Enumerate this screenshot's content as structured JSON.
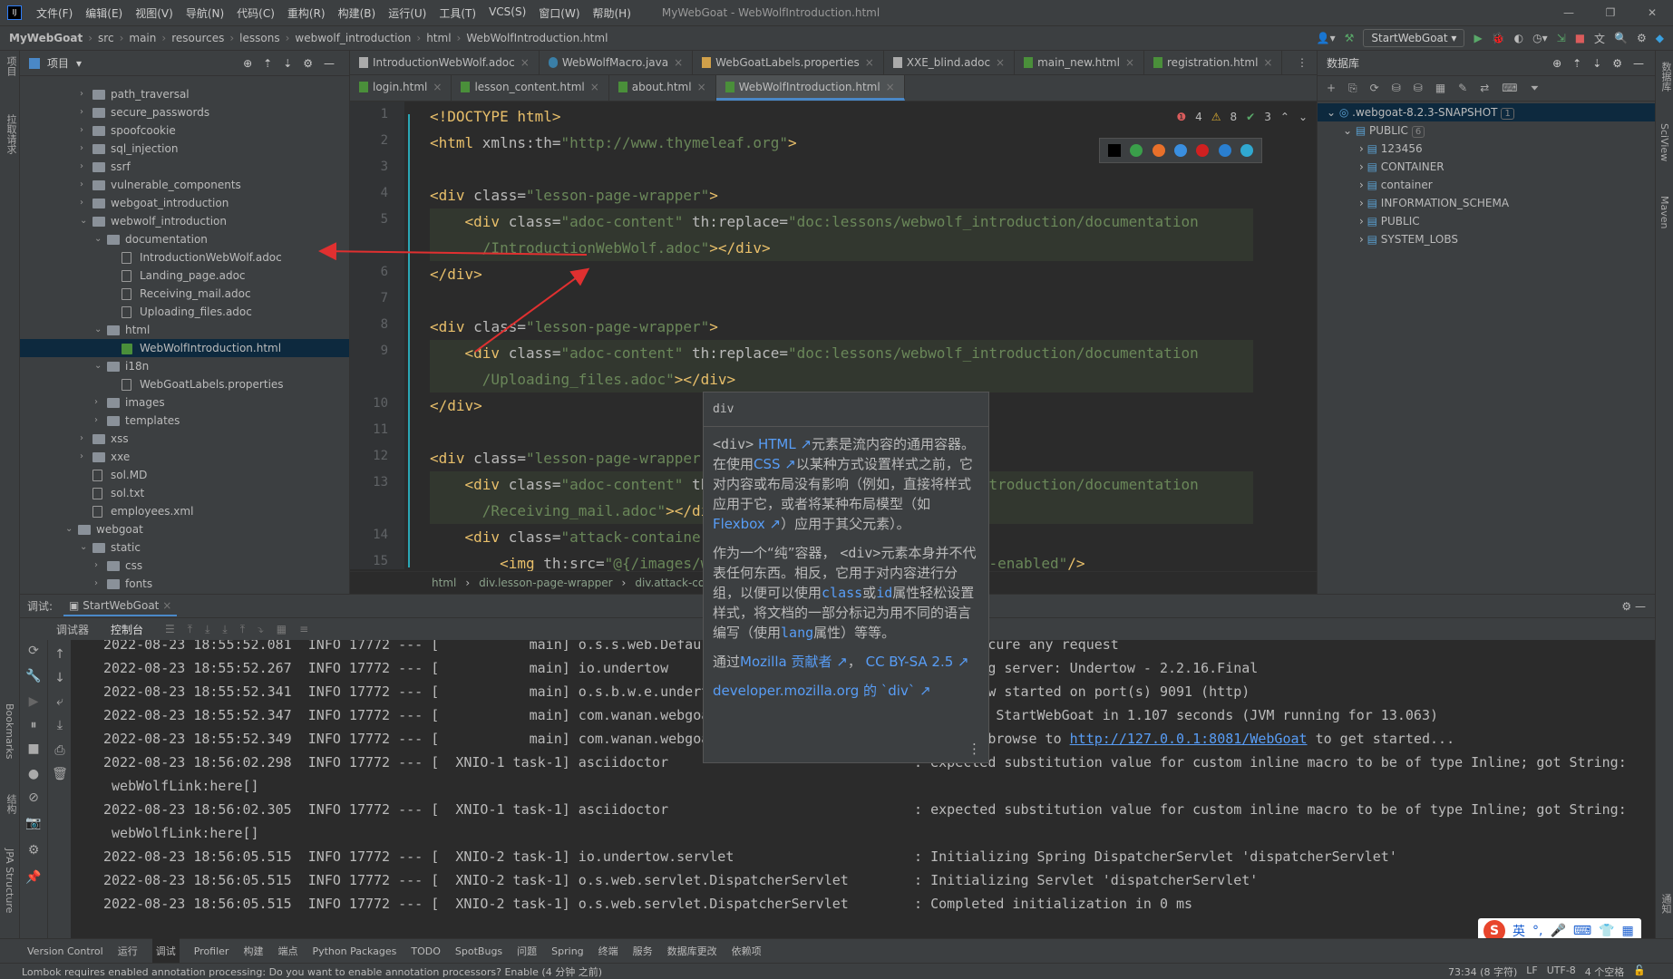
{
  "window": {
    "title": "MyWebGoat - WebWolfIntroduction.html",
    "controls": [
      "—",
      "❐",
      "✕"
    ]
  },
  "menu": [
    "文件(F)",
    "编辑(E)",
    "视图(V)",
    "导航(N)",
    "代码(C)",
    "重构(R)",
    "构建(B)",
    "运行(U)",
    "工具(T)",
    "VCS(S)",
    "窗口(W)",
    "帮助(H)"
  ],
  "breadcrumb": [
    "MyWebGoat",
    "src",
    "main",
    "resources",
    "lessons",
    "webwolf_introduction",
    "html",
    "WebWolfIntroduction.html"
  ],
  "run_config": "StartWebGoat",
  "left_strip": [
    "项目",
    "拉取请求",
    "Bookmarks",
    "结构",
    "JPA Structure"
  ],
  "right_strip": [
    "数据库",
    "SciView",
    "Maven",
    "通知"
  ],
  "project": {
    "title": "项目",
    "items": [
      {
        "label": "path_traversal",
        "level": 0,
        "type": "folder",
        "arrow": "›"
      },
      {
        "label": "secure_passwords",
        "level": 0,
        "type": "folder",
        "arrow": "›"
      },
      {
        "label": "spoofcookie",
        "level": 0,
        "type": "folder",
        "arrow": "›"
      },
      {
        "label": "sql_injection",
        "level": 0,
        "type": "folder",
        "arrow": "›"
      },
      {
        "label": "ssrf",
        "level": 0,
        "type": "folder",
        "arrow": "›"
      },
      {
        "label": "vulnerable_components",
        "level": 0,
        "type": "folder",
        "arrow": "›"
      },
      {
        "label": "webgoat_introduction",
        "level": 0,
        "type": "folder",
        "arrow": "›"
      },
      {
        "label": "webwolf_introduction",
        "level": 0,
        "type": "folder",
        "arrow": "⌄"
      },
      {
        "label": "documentation",
        "level": 1,
        "type": "folder",
        "arrow": "⌄"
      },
      {
        "label": "IntroductionWebWolf.adoc",
        "level": 2,
        "type": "file"
      },
      {
        "label": "Landing_page.adoc",
        "level": 2,
        "type": "file"
      },
      {
        "label": "Receiving_mail.adoc",
        "level": 2,
        "type": "file"
      },
      {
        "label": "Uploading_files.adoc",
        "level": 2,
        "type": "file"
      },
      {
        "label": "html",
        "level": 1,
        "type": "folder",
        "arrow": "⌄"
      },
      {
        "label": "WebWolfIntroduction.html",
        "level": 2,
        "type": "html",
        "selected": true
      },
      {
        "label": "i18n",
        "level": 1,
        "type": "folder",
        "arrow": "⌄"
      },
      {
        "label": "WebGoatLabels.properties",
        "level": 2,
        "type": "file"
      },
      {
        "label": "images",
        "level": 1,
        "type": "folder",
        "arrow": "›"
      },
      {
        "label": "templates",
        "level": 1,
        "type": "folder",
        "arrow": "›"
      },
      {
        "label": "xss",
        "level": 0,
        "type": "folder",
        "arrow": "›"
      },
      {
        "label": "xxe",
        "level": 0,
        "type": "folder",
        "arrow": "›"
      },
      {
        "label": "sol.MD",
        "level": 0,
        "type": "file"
      },
      {
        "label": "sol.txt",
        "level": 0,
        "type": "file"
      },
      {
        "label": "employees.xml",
        "level": 0,
        "type": "file"
      },
      {
        "label": "webgoat",
        "level": -1,
        "type": "folder",
        "arrow": "⌄"
      },
      {
        "label": "static",
        "level": 0,
        "type": "folder",
        "arrow": "⌄"
      },
      {
        "label": "css",
        "level": 1,
        "type": "folder",
        "arrow": "›"
      },
      {
        "label": "fonts",
        "level": 1,
        "type": "folder",
        "arrow": "›"
      },
      {
        "label": "js",
        "level": 1,
        "type": "folder",
        "arrow": "›"
      }
    ]
  },
  "editor": {
    "tabs_row1": [
      {
        "label": "IntroductionWebWolf.adoc",
        "icon": "ad"
      },
      {
        "label": "WebWolfMacro.java",
        "icon": "j"
      },
      {
        "label": "WebGoatLabels.properties",
        "icon": "p"
      },
      {
        "label": "XXE_blind.adoc",
        "icon": "ad"
      },
      {
        "label": "main_new.html",
        "icon": "h"
      },
      {
        "label": "registration.html",
        "icon": "h"
      }
    ],
    "tabs_row2": [
      {
        "label": "login.html"
      },
      {
        "label": "lesson_content.html"
      },
      {
        "label": "about.html"
      },
      {
        "label": "WebWolfIntroduction.html",
        "active": true
      }
    ],
    "inspections": {
      "errors": "4",
      "warnings": "8",
      "weak": "3"
    },
    "lines": [
      {
        "n": "1",
        "seg": [
          [
            "t",
            "<!DOCTYPE html>"
          ]
        ]
      },
      {
        "n": "2",
        "seg": [
          [
            "t",
            "<html "
          ],
          [
            "a",
            "xmlns:th="
          ],
          [
            "s",
            "\"http://www.thymeleaf.org\""
          ],
          [
            "t",
            ">"
          ]
        ]
      },
      {
        "n": "3",
        "seg": []
      },
      {
        "n": "4",
        "seg": [
          [
            "t",
            "<div "
          ],
          [
            "a",
            "class="
          ],
          [
            "s",
            "\"lesson-page-wrapper\""
          ],
          [
            "t",
            ">"
          ]
        ]
      },
      {
        "n": "5",
        "hl": true,
        "seg": [
          [
            "p",
            "    "
          ],
          [
            "t",
            "<div "
          ],
          [
            "a",
            "class="
          ],
          [
            "s",
            "\"adoc-content\" "
          ],
          [
            "a",
            "th:replace="
          ],
          [
            "s",
            "\"doc:lessons/webwolf_introduction/documentation"
          ]
        ]
      },
      {
        "n": "",
        "hl": true,
        "seg": [
          [
            "s",
            "      /IntroductionWebWolf.adoc\""
          ],
          [
            "t",
            "></div>"
          ]
        ]
      },
      {
        "n": "6",
        "seg": [
          [
            "t",
            "</div>"
          ]
        ]
      },
      {
        "n": "7",
        "seg": []
      },
      {
        "n": "8",
        "seg": [
          [
            "t",
            "<div "
          ],
          [
            "a",
            "class="
          ],
          [
            "s",
            "\"lesson-page-wrapper\""
          ],
          [
            "t",
            ">"
          ]
        ]
      },
      {
        "n": "9",
        "hl": true,
        "seg": [
          [
            "p",
            "    "
          ],
          [
            "t",
            "<div "
          ],
          [
            "a",
            "class="
          ],
          [
            "s",
            "\"adoc-content\" "
          ],
          [
            "a",
            "th:replace="
          ],
          [
            "s",
            "\"doc:lessons/webwolf_introduction/documentation"
          ]
        ]
      },
      {
        "n": "",
        "hl": true,
        "seg": [
          [
            "s",
            "      /Uploading_files.adoc\""
          ],
          [
            "t",
            "></div>"
          ]
        ]
      },
      {
        "n": "10",
        "seg": [
          [
            "t",
            "</div>"
          ]
        ]
      },
      {
        "n": "11",
        "seg": []
      },
      {
        "n": "12",
        "seg": [
          [
            "t",
            "<div "
          ],
          [
            "a",
            "class="
          ],
          [
            "s",
            "\"lesson-page-wrapper\""
          ],
          [
            "t",
            ">"
          ]
        ]
      },
      {
        "n": "13",
        "hl": true,
        "seg": [
          [
            "p",
            "    "
          ],
          [
            "t",
            "<div "
          ],
          [
            "a",
            "class="
          ],
          [
            "s",
            "\"adoc-content\" "
          ],
          [
            "a",
            "th:replace="
          ],
          [
            "s",
            "\"doc:lessons/webwolf_introduction/documentation"
          ]
        ]
      },
      {
        "n": "",
        "hl": true,
        "seg": [
          [
            "s",
            "      /Receiving_mail.adoc\""
          ],
          [
            "t",
            "></div>"
          ]
        ]
      },
      {
        "n": "14",
        "seg": [
          [
            "p",
            "    "
          ],
          [
            "t",
            "<div "
          ],
          [
            "a",
            "class="
          ],
          [
            "s",
            "\"attack-container\""
          ],
          [
            "t",
            ">"
          ]
        ]
      },
      {
        "n": "15",
        "seg": [
          [
            "p",
            "        "
          ],
          [
            "t",
            "<img "
          ],
          [
            "a",
            "th:src="
          ],
          [
            "s",
            "\"@{/images/wolf-enabled.png}\" "
          ],
          [
            "a",
            "class="
          ],
          [
            "s",
            "\"webwolf-enabled\""
          ],
          [
            "t",
            "/>"
          ]
        ]
      }
    ],
    "bottom_breadcrumb": [
      "html",
      "div.lesson-page-wrapper",
      "div.attack-container"
    ]
  },
  "tooltip": {
    "title": "div",
    "p1": [
      [
        "c",
        "<div>"
      ],
      [
        "t",
        " "
      ],
      [
        "l",
        "HTML ↗"
      ],
      [
        "t",
        "元素是流内容的通用容器。在使用"
      ],
      [
        "l",
        "CSS ↗"
      ],
      [
        "t",
        "以某种方式设置样式之前，它对内容或布局没有影响（例如，直接将样式应用于它，或者将某种布局模型（如"
      ],
      [
        "l",
        "Flexbox ↗"
      ],
      [
        "t",
        "）应用于其父元素）。"
      ]
    ],
    "p2": [
      [
        "t",
        "作为一个“纯”容器， "
      ],
      [
        "c",
        "<div>"
      ],
      [
        "t",
        "元素本身并不代表任何东西。相反，它用于对内容进行分组，以便可以使用"
      ],
      [
        "lm",
        "class"
      ],
      [
        "t",
        "或"
      ],
      [
        "lm",
        "id"
      ],
      [
        "t",
        "属性轻松设置样式，将文档的一部分标记为用不同的语言编写（使用"
      ],
      [
        "lm",
        "lang"
      ],
      [
        "t",
        "属性）等等。"
      ]
    ],
    "p3": [
      [
        "t",
        "通过"
      ],
      [
        "l",
        "Mozilla 贡献者 ↗"
      ],
      [
        "t",
        "， "
      ],
      [
        "l",
        "CC BY-SA 2.5 ↗"
      ]
    ],
    "p4": [
      [
        "l",
        "developer.mozilla.org 的 `div` ↗"
      ]
    ]
  },
  "database": {
    "title": "数据库",
    "items": [
      {
        "label": ".webgoat-8.2.3-SNAPSHOT",
        "badge": "1",
        "level": 0,
        "selected": true
      },
      {
        "label": "PUBLIC",
        "badge": "6",
        "level": 1
      },
      {
        "label": "123456",
        "level": 2
      },
      {
        "label": "CONTAINER",
        "level": 2
      },
      {
        "label": "container",
        "level": 2
      },
      {
        "label": "INFORMATION_SCHEMA",
        "level": 2
      },
      {
        "label": "PUBLIC",
        "level": 2
      },
      {
        "label": "SYSTEM_LOBS",
        "level": 2
      }
    ]
  },
  "debug": {
    "label": "调试:",
    "session": "StartWebGoat",
    "tabs": [
      "调试器",
      "控制台"
    ],
    "console": [
      "2022-08-23 18:55:52.081  INFO 17772 --- [           main] o.s.s.web.DefaultSecurityFilterChain     : Will secure any request",
      "2022-08-23 18:55:52.267  INFO 17772 --- [           main] io.undertow                              : starting server: Undertow - 2.2.16.Final",
      "2022-08-23 18:55:52.341  INFO 17772 --- [           main] o.s.b.w.e.undertow.UndertowWebServer     : Undertow started on port(s) 9091 (http)",
      "2022-08-23 18:55:52.347  INFO 17772 --- [           main] com.wanan.webgoat.server.StartWebGoat    : Started StartWebGoat in 1.107 seconds (JVM running for 13.063)",
      "2022-08-23 18:55:52.349  INFO 17772 --- [           main] com.wanan.webgoat.server.StartWebGoat    : Please browse to ",
      "2022-08-23 18:56:02.298  INFO 17772 --- [  XNIO-1 task-1] asciidoctor                              : expected substitution value for custom inline macro to be of type Inline; got String:",
      " webWolfLink:here[]",
      "2022-08-23 18:56:02.305  INFO 17772 --- [  XNIO-1 task-1] asciidoctor                              : expected substitution value for custom inline macro to be of type Inline; got String:",
      " webWolfLink:here[]",
      "2022-08-23 18:56:05.515  INFO 17772 --- [  XNIO-2 task-1] io.undertow.servlet                      : Initializing Spring DispatcherServlet 'dispatcherServlet'",
      "2022-08-23 18:56:05.515  INFO 17772 --- [  XNIO-2 task-1] o.s.web.servlet.DispatcherServlet        : Initializing Servlet 'dispatcherServlet'",
      "2022-08-23 18:56:05.515  INFO 17772 --- [  XNIO-2 task-1] o.s.web.servlet.DispatcherServlet        : Completed initialization in 0 ms"
    ],
    "link": "http://127.0.0.1:8081/WebGoat",
    "link_suffix": " to get started..."
  },
  "bottom_tools": [
    "Version Control",
    "运行",
    "调试",
    "Profiler",
    "构建",
    "端点",
    "Python Packages",
    "TODO",
    "SpotBugs",
    "问题",
    "Spring",
    "终端",
    "服务",
    "数据库更改",
    "依赖项"
  ],
  "status": {
    "message": "Lombok requires enabled annotation processing: Do you want to enable annotation processors? Enable (4 分钟 之前)",
    "position": "73:34 (8 字符)",
    "line_sep": "LF",
    "encoding": "UTF-8",
    "indent": "4 个空格"
  },
  "ime": {
    "logo": "S",
    "mode": "英"
  },
  "colors": {
    "accent": "#4a88c7",
    "arrow": "#e03030",
    "link": "#589df6"
  }
}
